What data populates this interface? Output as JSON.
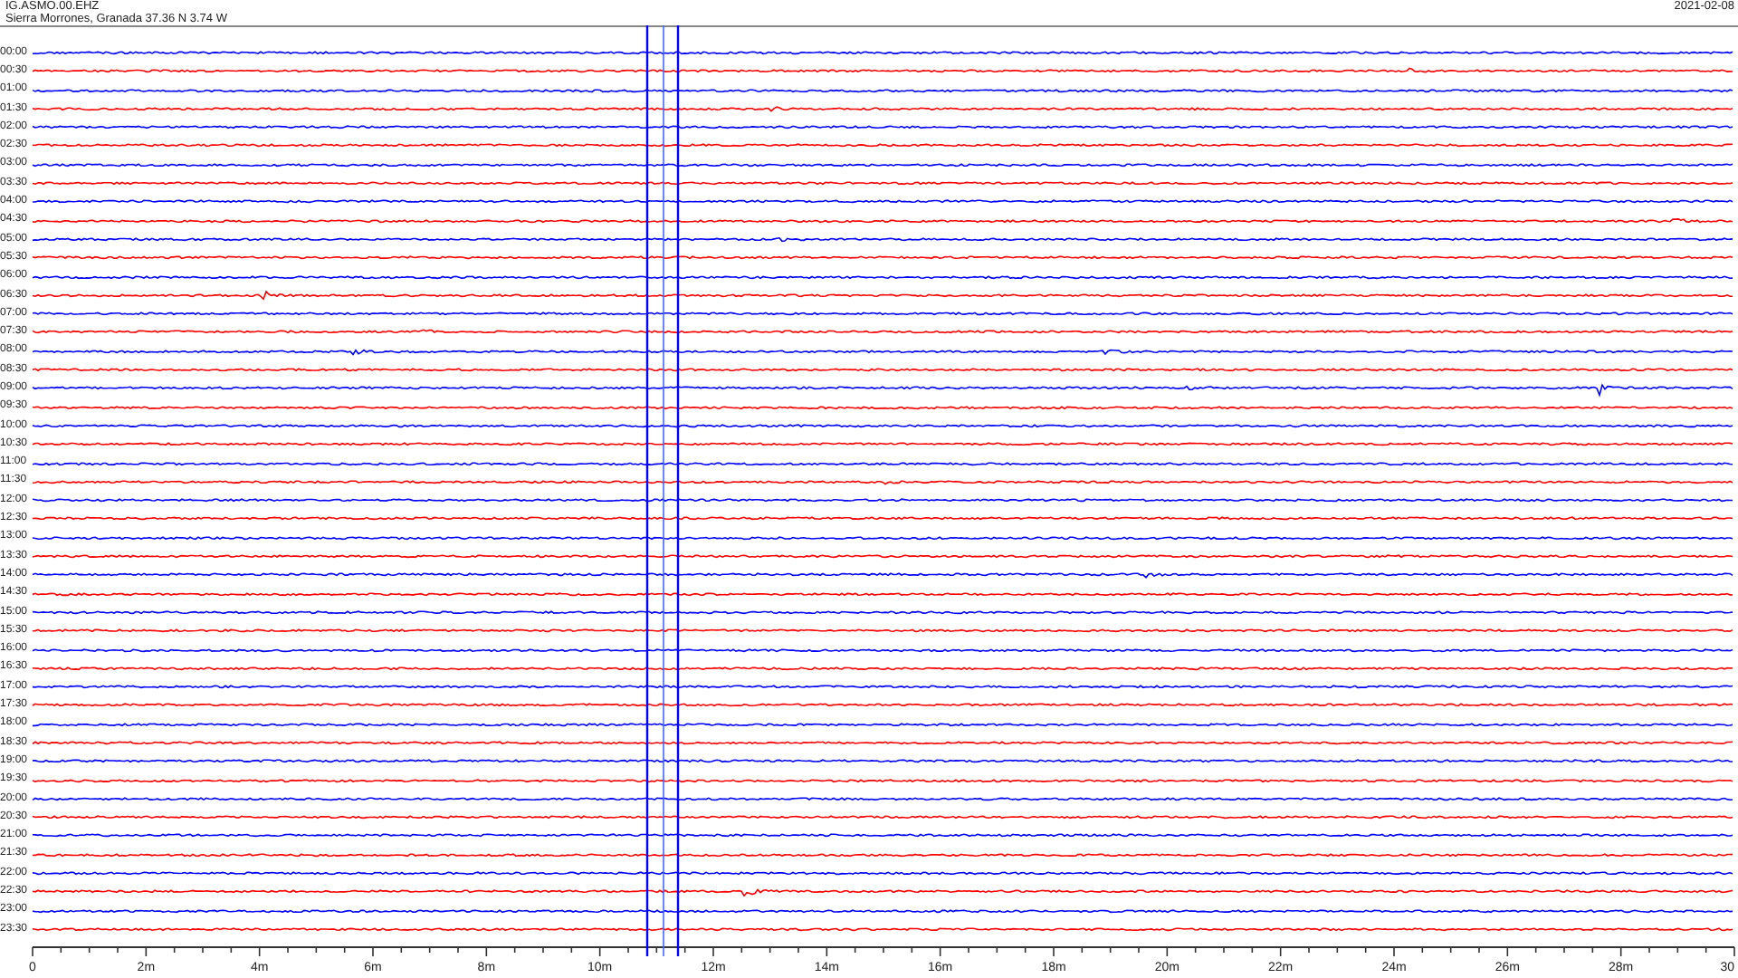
{
  "header": {
    "station": "IG.ASMO.00.EHZ",
    "location": "Sierra Morrones, Granada  37.36 N 3.74 W",
    "date": "2021-02-08"
  },
  "rows": [
    {
      "time": "00:00",
      "color": "#0000ff"
    },
    {
      "time": "00:30",
      "color": "#ff0000"
    },
    {
      "time": "01:00",
      "color": "#0000ff"
    },
    {
      "time": "01:30",
      "color": "#ff0000"
    },
    {
      "time": "02:00",
      "color": "#0000ff"
    },
    {
      "time": "02:30",
      "color": "#ff0000"
    },
    {
      "time": "03:00",
      "color": "#0000ff"
    },
    {
      "time": "03:30",
      "color": "#ff0000"
    },
    {
      "time": "04:00",
      "color": "#0000ff"
    },
    {
      "time": "04:30",
      "color": "#ff0000"
    },
    {
      "time": "05:00",
      "color": "#0000ff"
    },
    {
      "time": "05:30",
      "color": "#ff0000"
    },
    {
      "time": "06:00",
      "color": "#0000ff"
    },
    {
      "time": "06:30",
      "color": "#ff0000"
    },
    {
      "time": "07:00",
      "color": "#0000ff"
    },
    {
      "time": "07:30",
      "color": "#ff0000"
    },
    {
      "time": "08:00",
      "color": "#0000ff"
    },
    {
      "time": "08:30",
      "color": "#ff0000"
    },
    {
      "time": "09:00",
      "color": "#0000ff"
    },
    {
      "time": "09:30",
      "color": "#ff0000"
    },
    {
      "time": "10:00",
      "color": "#0000ff"
    },
    {
      "time": "10:30",
      "color": "#ff0000"
    },
    {
      "time": "11:00",
      "color": "#0000ff"
    },
    {
      "time": "11:30",
      "color": "#ff0000"
    },
    {
      "time": "12:00",
      "color": "#0000ff"
    },
    {
      "time": "12:30",
      "color": "#ff0000"
    },
    {
      "time": "13:00",
      "color": "#0000ff"
    },
    {
      "time": "13:30",
      "color": "#ff0000"
    },
    {
      "time": "14:00",
      "color": "#0000ff"
    },
    {
      "time": "14:30",
      "color": "#ff0000"
    },
    {
      "time": "15:00",
      "color": "#0000ff"
    },
    {
      "time": "15:30",
      "color": "#ff0000"
    },
    {
      "time": "16:00",
      "color": "#0000ff"
    },
    {
      "time": "16:30",
      "color": "#ff0000"
    },
    {
      "time": "17:00",
      "color": "#0000ff"
    },
    {
      "time": "17:30",
      "color": "#ff0000"
    },
    {
      "time": "18:00",
      "color": "#0000ff"
    },
    {
      "time": "18:30",
      "color": "#ff0000"
    },
    {
      "time": "19:00",
      "color": "#0000ff"
    },
    {
      "time": "19:30",
      "color": "#ff0000"
    },
    {
      "time": "20:00",
      "color": "#0000ff"
    },
    {
      "time": "20:30",
      "color": "#ff0000"
    },
    {
      "time": "21:00",
      "color": "#0000ff"
    },
    {
      "time": "21:30",
      "color": "#ff0000"
    },
    {
      "time": "22:00",
      "color": "#0000ff"
    },
    {
      "time": "22:30",
      "color": "#ff0000"
    },
    {
      "time": "23:00",
      "color": "#0000ff"
    },
    {
      "time": "23:30",
      "color": "#ff0000"
    }
  ],
  "axis": {
    "labels": [
      "0",
      "2m",
      "4m",
      "6m",
      "8m",
      "10m",
      "12m",
      "14m",
      "16m",
      "18m",
      "20m",
      "22m",
      "24m",
      "26m",
      "28m",
      "30"
    ]
  }
}
